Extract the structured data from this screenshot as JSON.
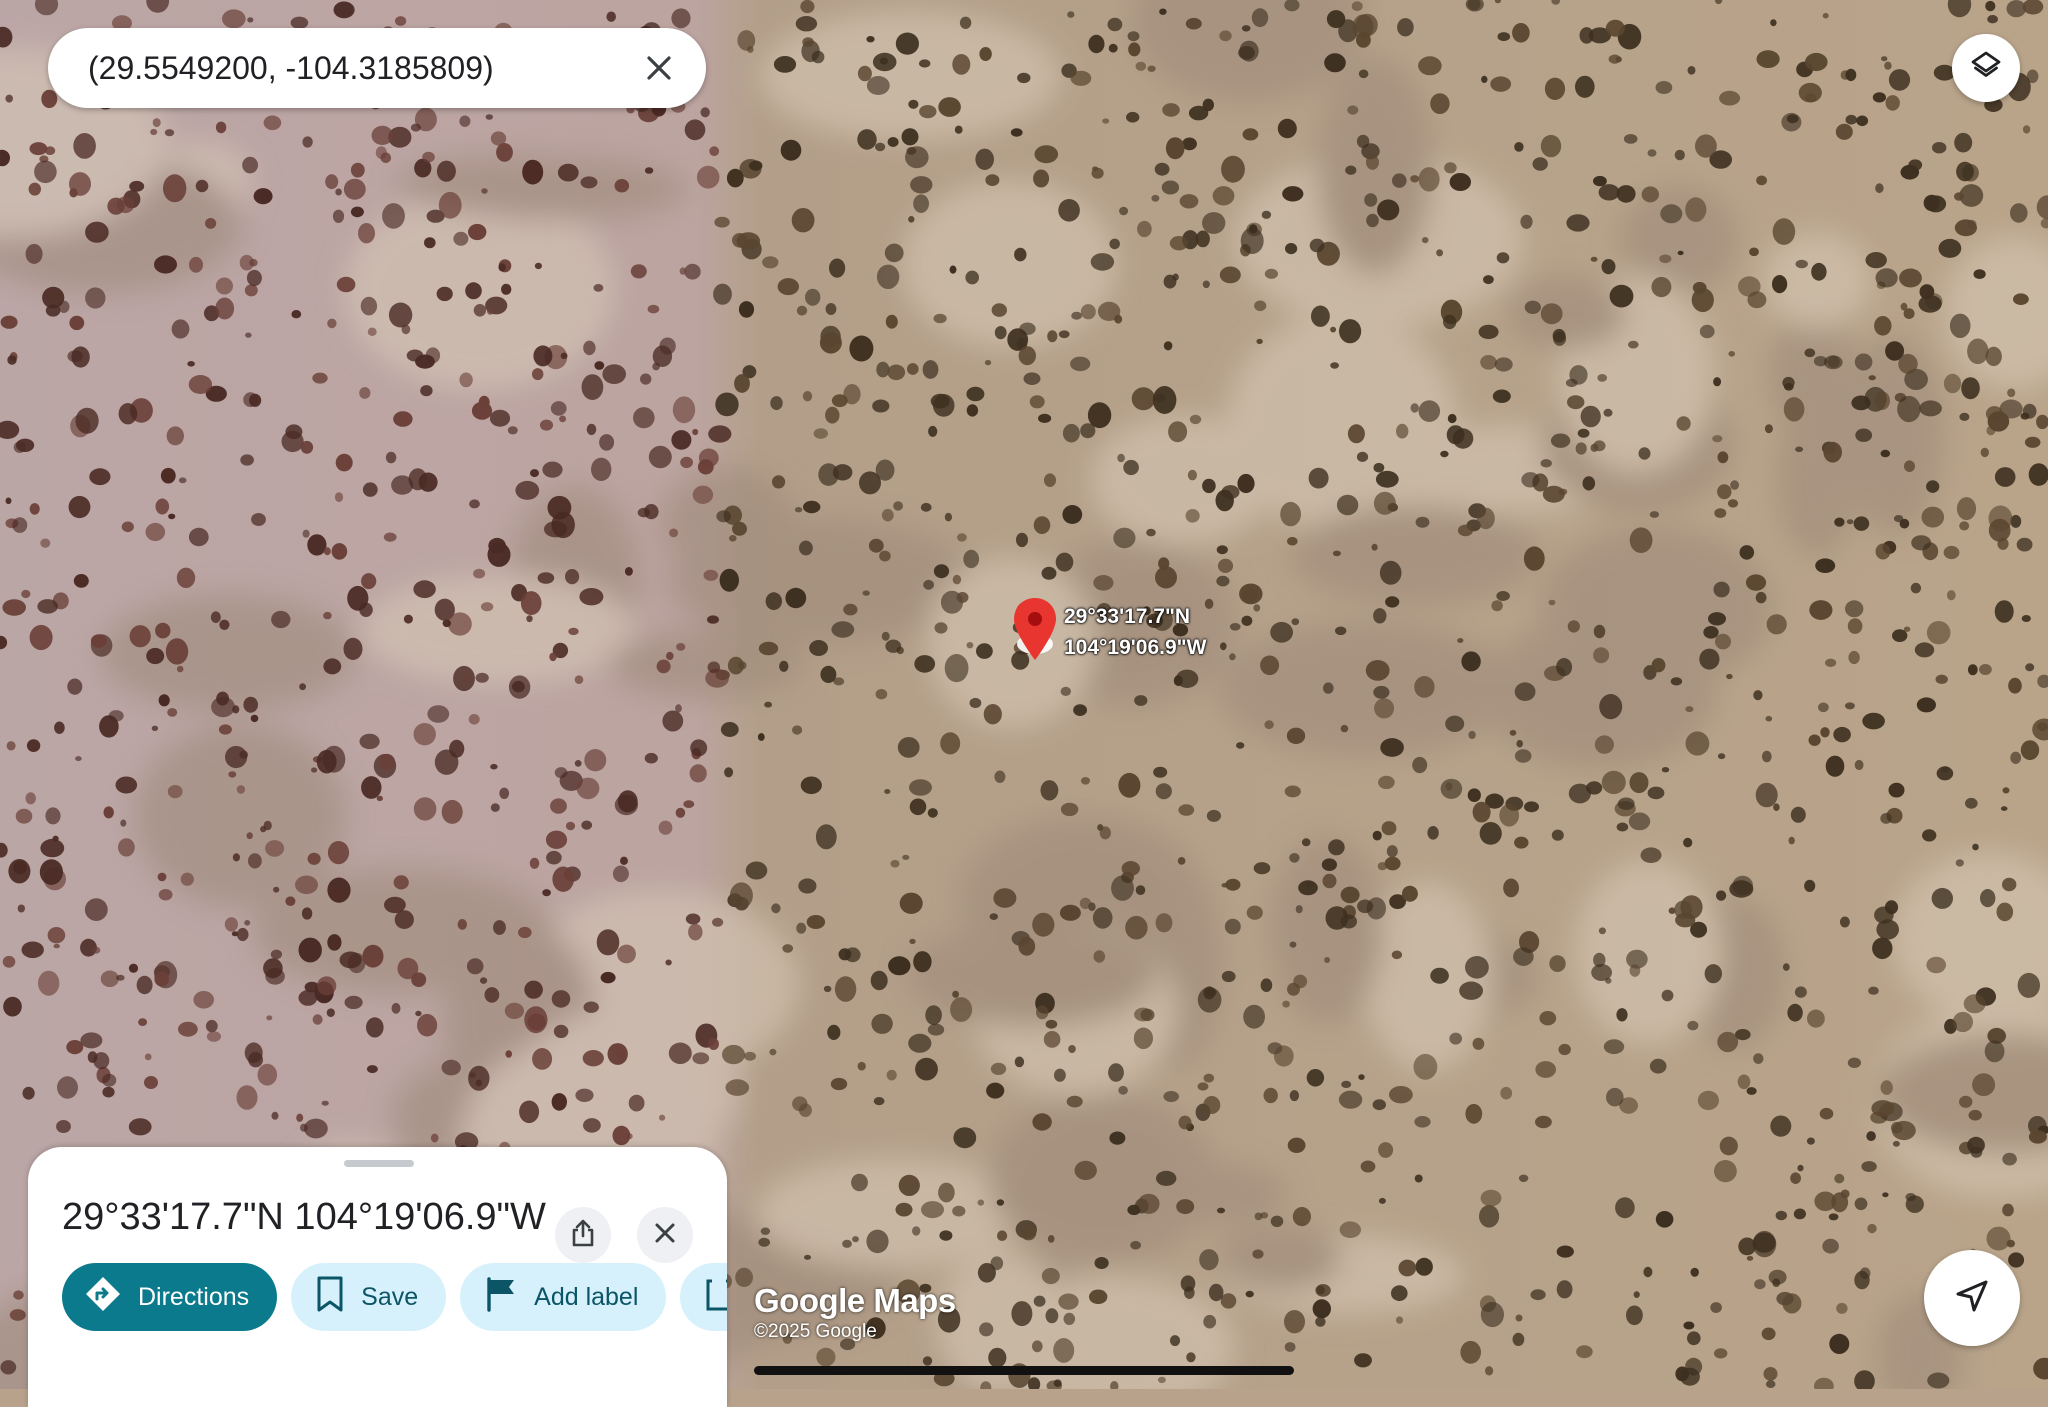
{
  "search": {
    "query": "(29.5549200, -104.3185809)"
  },
  "marker": {
    "lat_label": "29°33'17.7\"N",
    "lng_label": "104°19'06.9\"W"
  },
  "sheet": {
    "title": "29°33'17.7\"N 104°19'06.9\"W",
    "actions": [
      {
        "label": "Directions",
        "icon": "directions-icon"
      },
      {
        "label": "Save",
        "icon": "bookmark-icon"
      },
      {
        "label": "Add label",
        "icon": "flag-icon"
      }
    ]
  },
  "attribution": {
    "logo": "Google Maps",
    "copyright": "©2025 Google"
  },
  "icons": {
    "layers": "layers-icon",
    "navigate": "navigation-arrow-icon",
    "share": "share-icon",
    "close": "close-icon"
  },
  "colors": {
    "primary_chip": "#0b7a8c",
    "secondary_chip": "#d6f1fb",
    "marker": "#e8352f"
  }
}
